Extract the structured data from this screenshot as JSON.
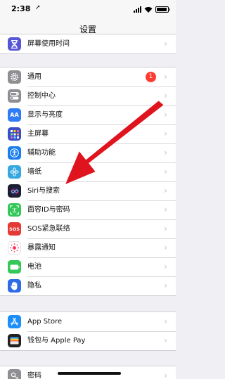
{
  "status_bar": {
    "time": "2:38",
    "location_glyph": "➚",
    "icons": [
      "signal-icon",
      "wifi-icon",
      "battery-icon"
    ],
    "battery_level": 0.9
  },
  "nav": {
    "title": "设置"
  },
  "groups": [
    {
      "items": [
        {
          "id": "screen-time",
          "label": "屏幕使用时间",
          "icon": "hourglass-icon",
          "color": "#5856d6"
        }
      ]
    },
    {
      "items": [
        {
          "id": "general",
          "label": "通用",
          "icon": "gear-icon",
          "color": "#8e8e93",
          "badge": "1"
        },
        {
          "id": "control-center",
          "label": "控制中心",
          "icon": "toggles-icon",
          "color": "#8e8e93"
        },
        {
          "id": "display-brightness",
          "label": "显示与亮度",
          "icon": "text-size-icon",
          "color": "#2f7cf6"
        },
        {
          "id": "home-screen",
          "label": "主屏幕",
          "icon": "grid-icon",
          "color": "#3a4ec8"
        },
        {
          "id": "accessibility",
          "label": "辅助功能",
          "icon": "accessibility-icon",
          "color": "#1a7ef0"
        },
        {
          "id": "wallpaper",
          "label": "墙纸",
          "icon": "flower-icon",
          "color": "#36a8e0"
        },
        {
          "id": "siri-search",
          "label": "Siri与搜索",
          "icon": "siri-icon",
          "color": "#1d1d30"
        },
        {
          "id": "face-id",
          "label": "面容ID与密码",
          "icon": "face-id-icon",
          "color": "#34c759"
        },
        {
          "id": "emergency-sos",
          "label": "SOS紧急联络",
          "icon": "sos-icon",
          "color": "#e53935"
        },
        {
          "id": "exposure",
          "label": "暴露通知",
          "icon": "exposure-icon",
          "color": "#ffffff"
        },
        {
          "id": "battery",
          "label": "电池",
          "icon": "battery-settings-icon",
          "color": "#34c759"
        },
        {
          "id": "privacy",
          "label": "隐私",
          "icon": "hand-icon",
          "color": "#2e6be6"
        }
      ]
    },
    {
      "items": [
        {
          "id": "app-store",
          "label": "App Store",
          "icon": "app-store-icon",
          "color": "#1c8ef9"
        },
        {
          "id": "wallet",
          "label": "钱包与 Apple Pay",
          "icon": "wallet-icon",
          "color": "#222222"
        }
      ]
    },
    {
      "items": [
        {
          "id": "passwords",
          "label": "密码",
          "icon": "key-icon",
          "color": "#8e8e93"
        }
      ]
    }
  ],
  "annotation": {
    "shape": "arrow-icon",
    "color": "#e0141e"
  }
}
